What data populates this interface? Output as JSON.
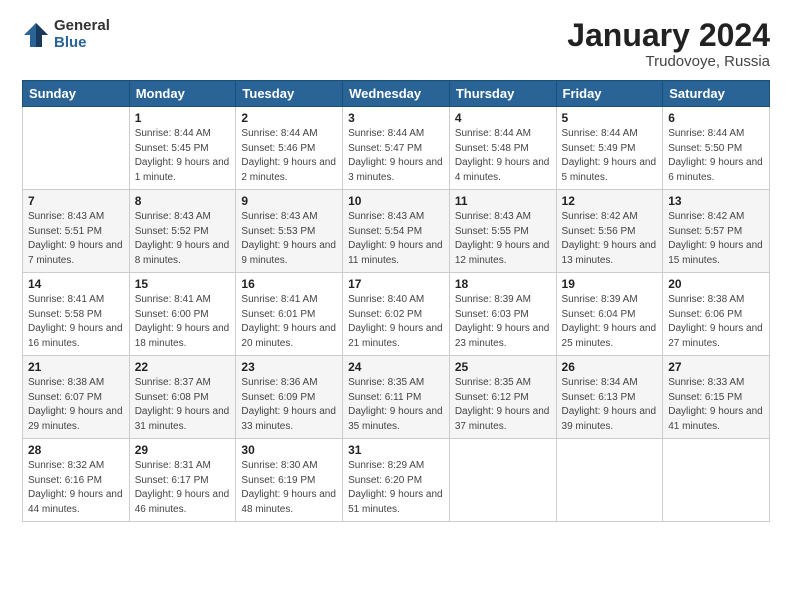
{
  "logo": {
    "general": "General",
    "blue": "Blue"
  },
  "header": {
    "month": "January 2024",
    "location": "Trudovoye, Russia"
  },
  "weekdays": [
    "Sunday",
    "Monday",
    "Tuesday",
    "Wednesday",
    "Thursday",
    "Friday",
    "Saturday"
  ],
  "weeks": [
    [
      {
        "day": "",
        "sunrise": "",
        "sunset": "",
        "daylight": ""
      },
      {
        "day": "1",
        "sunrise": "Sunrise: 8:44 AM",
        "sunset": "Sunset: 5:45 PM",
        "daylight": "Daylight: 9 hours and 1 minute."
      },
      {
        "day": "2",
        "sunrise": "Sunrise: 8:44 AM",
        "sunset": "Sunset: 5:46 PM",
        "daylight": "Daylight: 9 hours and 2 minutes."
      },
      {
        "day": "3",
        "sunrise": "Sunrise: 8:44 AM",
        "sunset": "Sunset: 5:47 PM",
        "daylight": "Daylight: 9 hours and 3 minutes."
      },
      {
        "day": "4",
        "sunrise": "Sunrise: 8:44 AM",
        "sunset": "Sunset: 5:48 PM",
        "daylight": "Daylight: 9 hours and 4 minutes."
      },
      {
        "day": "5",
        "sunrise": "Sunrise: 8:44 AM",
        "sunset": "Sunset: 5:49 PM",
        "daylight": "Daylight: 9 hours and 5 minutes."
      },
      {
        "day": "6",
        "sunrise": "Sunrise: 8:44 AM",
        "sunset": "Sunset: 5:50 PM",
        "daylight": "Daylight: 9 hours and 6 minutes."
      }
    ],
    [
      {
        "day": "7",
        "sunrise": "Sunrise: 8:43 AM",
        "sunset": "Sunset: 5:51 PM",
        "daylight": "Daylight: 9 hours and 7 minutes."
      },
      {
        "day": "8",
        "sunrise": "Sunrise: 8:43 AM",
        "sunset": "Sunset: 5:52 PM",
        "daylight": "Daylight: 9 hours and 8 minutes."
      },
      {
        "day": "9",
        "sunrise": "Sunrise: 8:43 AM",
        "sunset": "Sunset: 5:53 PM",
        "daylight": "Daylight: 9 hours and 9 minutes."
      },
      {
        "day": "10",
        "sunrise": "Sunrise: 8:43 AM",
        "sunset": "Sunset: 5:54 PM",
        "daylight": "Daylight: 9 hours and 11 minutes."
      },
      {
        "day": "11",
        "sunrise": "Sunrise: 8:43 AM",
        "sunset": "Sunset: 5:55 PM",
        "daylight": "Daylight: 9 hours and 12 minutes."
      },
      {
        "day": "12",
        "sunrise": "Sunrise: 8:42 AM",
        "sunset": "Sunset: 5:56 PM",
        "daylight": "Daylight: 9 hours and 13 minutes."
      },
      {
        "day": "13",
        "sunrise": "Sunrise: 8:42 AM",
        "sunset": "Sunset: 5:57 PM",
        "daylight": "Daylight: 9 hours and 15 minutes."
      }
    ],
    [
      {
        "day": "14",
        "sunrise": "Sunrise: 8:41 AM",
        "sunset": "Sunset: 5:58 PM",
        "daylight": "Daylight: 9 hours and 16 minutes."
      },
      {
        "day": "15",
        "sunrise": "Sunrise: 8:41 AM",
        "sunset": "Sunset: 6:00 PM",
        "daylight": "Daylight: 9 hours and 18 minutes."
      },
      {
        "day": "16",
        "sunrise": "Sunrise: 8:41 AM",
        "sunset": "Sunset: 6:01 PM",
        "daylight": "Daylight: 9 hours and 20 minutes."
      },
      {
        "day": "17",
        "sunrise": "Sunrise: 8:40 AM",
        "sunset": "Sunset: 6:02 PM",
        "daylight": "Daylight: 9 hours and 21 minutes."
      },
      {
        "day": "18",
        "sunrise": "Sunrise: 8:39 AM",
        "sunset": "Sunset: 6:03 PM",
        "daylight": "Daylight: 9 hours and 23 minutes."
      },
      {
        "day": "19",
        "sunrise": "Sunrise: 8:39 AM",
        "sunset": "Sunset: 6:04 PM",
        "daylight": "Daylight: 9 hours and 25 minutes."
      },
      {
        "day": "20",
        "sunrise": "Sunrise: 8:38 AM",
        "sunset": "Sunset: 6:06 PM",
        "daylight": "Daylight: 9 hours and 27 minutes."
      }
    ],
    [
      {
        "day": "21",
        "sunrise": "Sunrise: 8:38 AM",
        "sunset": "Sunset: 6:07 PM",
        "daylight": "Daylight: 9 hours and 29 minutes."
      },
      {
        "day": "22",
        "sunrise": "Sunrise: 8:37 AM",
        "sunset": "Sunset: 6:08 PM",
        "daylight": "Daylight: 9 hours and 31 minutes."
      },
      {
        "day": "23",
        "sunrise": "Sunrise: 8:36 AM",
        "sunset": "Sunset: 6:09 PM",
        "daylight": "Daylight: 9 hours and 33 minutes."
      },
      {
        "day": "24",
        "sunrise": "Sunrise: 8:35 AM",
        "sunset": "Sunset: 6:11 PM",
        "daylight": "Daylight: 9 hours and 35 minutes."
      },
      {
        "day": "25",
        "sunrise": "Sunrise: 8:35 AM",
        "sunset": "Sunset: 6:12 PM",
        "daylight": "Daylight: 9 hours and 37 minutes."
      },
      {
        "day": "26",
        "sunrise": "Sunrise: 8:34 AM",
        "sunset": "Sunset: 6:13 PM",
        "daylight": "Daylight: 9 hours and 39 minutes."
      },
      {
        "day": "27",
        "sunrise": "Sunrise: 8:33 AM",
        "sunset": "Sunset: 6:15 PM",
        "daylight": "Daylight: 9 hours and 41 minutes."
      }
    ],
    [
      {
        "day": "28",
        "sunrise": "Sunrise: 8:32 AM",
        "sunset": "Sunset: 6:16 PM",
        "daylight": "Daylight: 9 hours and 44 minutes."
      },
      {
        "day": "29",
        "sunrise": "Sunrise: 8:31 AM",
        "sunset": "Sunset: 6:17 PM",
        "daylight": "Daylight: 9 hours and 46 minutes."
      },
      {
        "day": "30",
        "sunrise": "Sunrise: 8:30 AM",
        "sunset": "Sunset: 6:19 PM",
        "daylight": "Daylight: 9 hours and 48 minutes."
      },
      {
        "day": "31",
        "sunrise": "Sunrise: 8:29 AM",
        "sunset": "Sunset: 6:20 PM",
        "daylight": "Daylight: 9 hours and 51 minutes."
      },
      {
        "day": "",
        "sunrise": "",
        "sunset": "",
        "daylight": ""
      },
      {
        "day": "",
        "sunrise": "",
        "sunset": "",
        "daylight": ""
      },
      {
        "day": "",
        "sunrise": "",
        "sunset": "",
        "daylight": ""
      }
    ]
  ]
}
